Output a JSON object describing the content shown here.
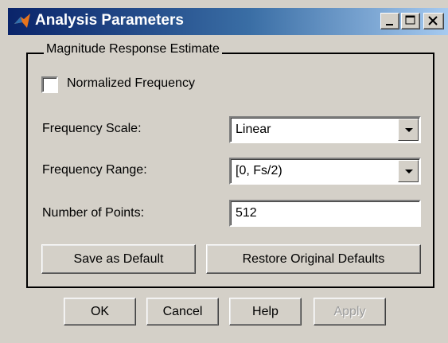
{
  "window": {
    "title": "Analysis Parameters"
  },
  "group": {
    "title": "Magnitude Response Estimate"
  },
  "normalized": {
    "label": "Normalized Frequency",
    "checked": false
  },
  "scale": {
    "label": "Frequency Scale:",
    "value": "Linear"
  },
  "range": {
    "label": "Frequency Range:",
    "value": "[0, Fs/2)"
  },
  "points": {
    "label": "Number of Points:",
    "value": "512"
  },
  "buttons": {
    "save_default": "Save as Default",
    "restore_defaults": "Restore Original Defaults",
    "ok": "OK",
    "cancel": "Cancel",
    "help": "Help",
    "apply": "Apply"
  }
}
